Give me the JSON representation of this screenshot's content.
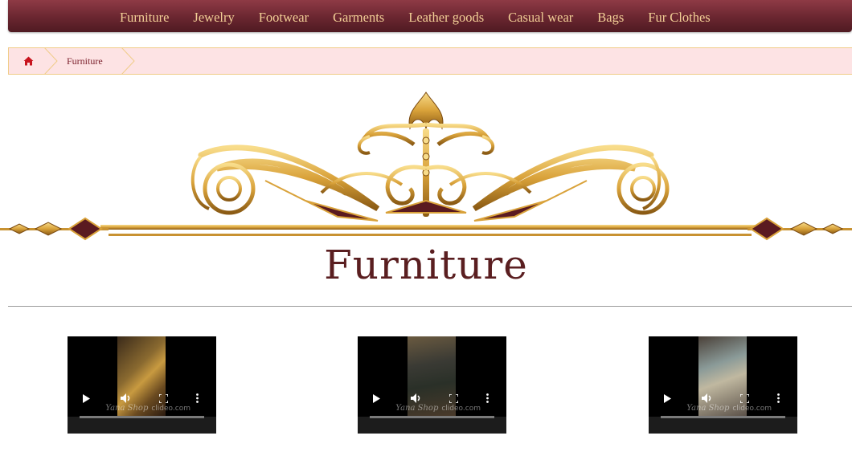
{
  "nav": {
    "items": [
      {
        "label": "Furniture"
      },
      {
        "label": "Jewelry"
      },
      {
        "label": "Footwear"
      },
      {
        "label": "Garments"
      },
      {
        "label": "Leather goods"
      },
      {
        "label": "Casual wear"
      },
      {
        "label": "Bags"
      },
      {
        "label": "Fur Clothes"
      }
    ]
  },
  "breadcrumb": {
    "home_icon": "home-icon",
    "current": "Furniture"
  },
  "banner": {
    "title": "Furniture"
  },
  "videos": [
    {
      "watermark": "Yana Shop",
      "site": "clideo.com"
    },
    {
      "watermark": "Yana Shop",
      "site": "clideo.com"
    },
    {
      "watermark": "Yana Shop",
      "site": "clideo.com"
    }
  ],
  "video_control_icons": [
    "play-icon",
    "volume-icon",
    "fullscreen-icon",
    "more-options-icon"
  ],
  "colors": {
    "nav_bg": "#6a2630",
    "nav_text": "#f2cf96",
    "breadcrumb_bg": "#fde3e4",
    "breadcrumb_border": "#f0cc88",
    "breadcrumb_text": "#7a1f2b",
    "gold": "#d9a23a",
    "title": "#5a1e20"
  }
}
